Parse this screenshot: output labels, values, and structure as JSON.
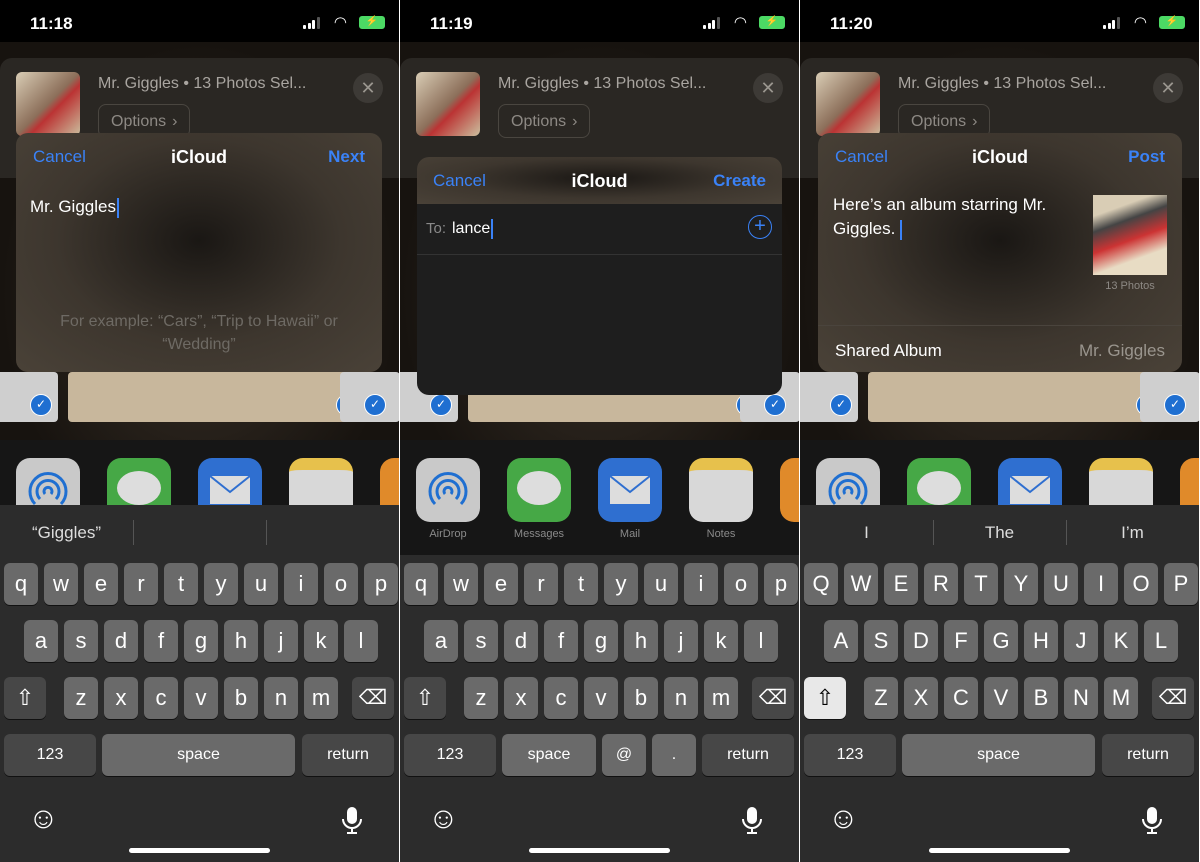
{
  "accent": "#3a82f7",
  "panels": [
    {
      "time": "11:18",
      "share_title": "Mr. Giggles • 13 Photos Sel...",
      "options_label": "Options",
      "dialog": {
        "cancel": "Cancel",
        "title": "iCloud",
        "action": "Next",
        "text": "Mr. Giggles",
        "placeholder_line1": "For example: “Cars”, “Trip to Hawaii” or",
        "placeholder_line2": "“Wedding”"
      },
      "suggestions": [
        "“Giggles”",
        "",
        ""
      ],
      "keyboard": {
        "case": "lower",
        "row4": [
          "123",
          "space",
          "return"
        ],
        "shift_active": false
      }
    },
    {
      "time": "11:19",
      "share_title": "Mr. Giggles • 13 Photos Sel...",
      "options_label": "Options",
      "dialog": {
        "cancel": "Cancel",
        "title": "iCloud",
        "action": "Create",
        "to_label": "To:",
        "to_value": "lance"
      },
      "apps": [
        "AirDrop",
        "Messages",
        "Mail",
        "Notes"
      ],
      "keyboard": {
        "case": "lower",
        "row4": [
          "123",
          "space",
          "@",
          ".",
          "return"
        ],
        "shift_active": false
      }
    },
    {
      "time": "11:20",
      "share_title": "Mr. Giggles • 13 Photos Sel...",
      "options_label": "Options",
      "dialog": {
        "cancel": "Cancel",
        "title": "iCloud",
        "action": "Post",
        "text_line1": "Here’s an album starring Mr.",
        "text_line2": "Giggles.",
        "photo_count": "13 Photos",
        "album_label": "Shared Album",
        "album_value": "Mr. Giggles"
      },
      "suggestions": [
        "I",
        "The",
        "I’m"
      ],
      "keyboard": {
        "case": "upper",
        "row4": [
          "123",
          "space",
          "return"
        ],
        "shift_active": true
      }
    }
  ],
  "keys": {
    "row1": [
      "q",
      "w",
      "e",
      "r",
      "t",
      "y",
      "u",
      "i",
      "o",
      "p"
    ],
    "row2": [
      "a",
      "s",
      "d",
      "f",
      "g",
      "h",
      "j",
      "k",
      "l"
    ],
    "row3": [
      "z",
      "x",
      "c",
      "v",
      "b",
      "n",
      "m"
    ]
  },
  "icons": {
    "shift": "⇧",
    "delete": "⌫",
    "emoji": "☺",
    "mic": "🎤",
    "close": "✕",
    "add": "⊕",
    "check": "✓"
  }
}
